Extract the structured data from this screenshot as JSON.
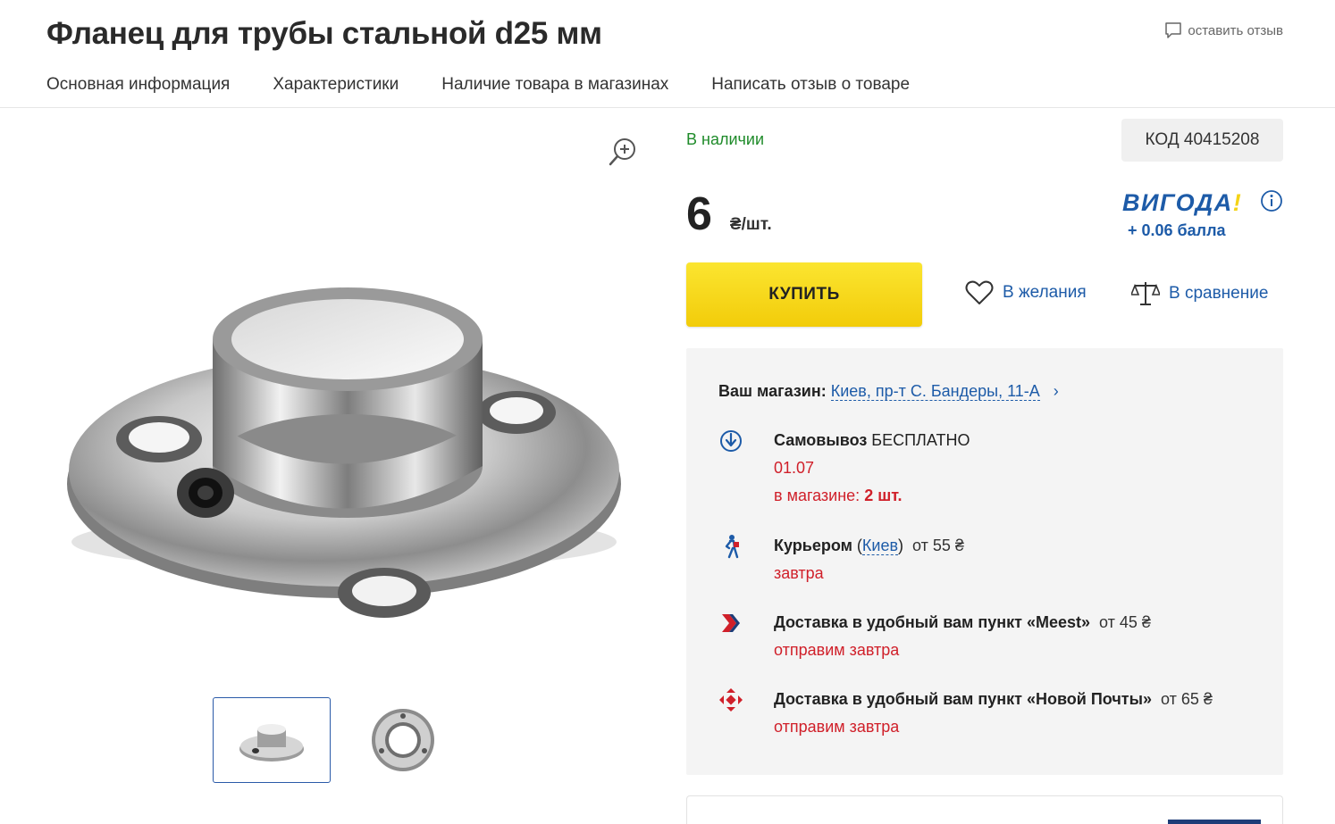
{
  "header": {
    "title": "Фланец для трубы стальной d25 мм",
    "review_link": "оставить отзыв",
    "nav": [
      "Основная информация",
      "Характеристики",
      "Наличие товара в магазинах",
      "Написать отзыв о товаре"
    ]
  },
  "product": {
    "stock": "В наличии",
    "code": "КОД 40415208",
    "price": "6",
    "price_unit": "₴/шт.",
    "vigoda_logo": "ВИГОДА",
    "vigoda_excl": "!",
    "vigoda_points": "+ 0.06 балла",
    "buy_label": "КУПИТЬ",
    "wishlist_label": "В желания",
    "compare_label": "В сравнение"
  },
  "delivery": {
    "store_label": "Ваш магазин:",
    "store_value": "Киев, пр-т С. Бандеры, 11-А",
    "store_chevron": "›",
    "pickup": {
      "title": "Самовывоз",
      "title_extra": "БЕСПЛАТНО",
      "date": "01.07",
      "in_store_label": "в магазине:",
      "in_store_count": "2 шт."
    },
    "courier": {
      "title": "Курьером",
      "open_paren": "(",
      "city": "Киев",
      "close_paren": ")",
      "price": "от 55 ₴",
      "when": "завтра"
    },
    "meest": {
      "title": "Доставка в удобный вам пункт «Meest»",
      "price": "от 45 ₴",
      "when": "отправим завтра"
    },
    "novaposhta": {
      "title": "Доставка в удобный вам пункт «Новой Почты»",
      "price": "от 65 ₴",
      "when": "отправим завтра"
    }
  },
  "colors": {
    "accent_blue": "#1d5ba8",
    "in_stock_green": "#1f8b2a",
    "alert_red": "#d0202a",
    "buy_yellow": "#f7d71c"
  },
  "icons": [
    "comment-icon",
    "zoom-in-icon",
    "info-icon",
    "heart-icon",
    "scales-icon",
    "pickup-icon",
    "courier-icon",
    "meest-icon",
    "novaposhta-icon"
  ]
}
